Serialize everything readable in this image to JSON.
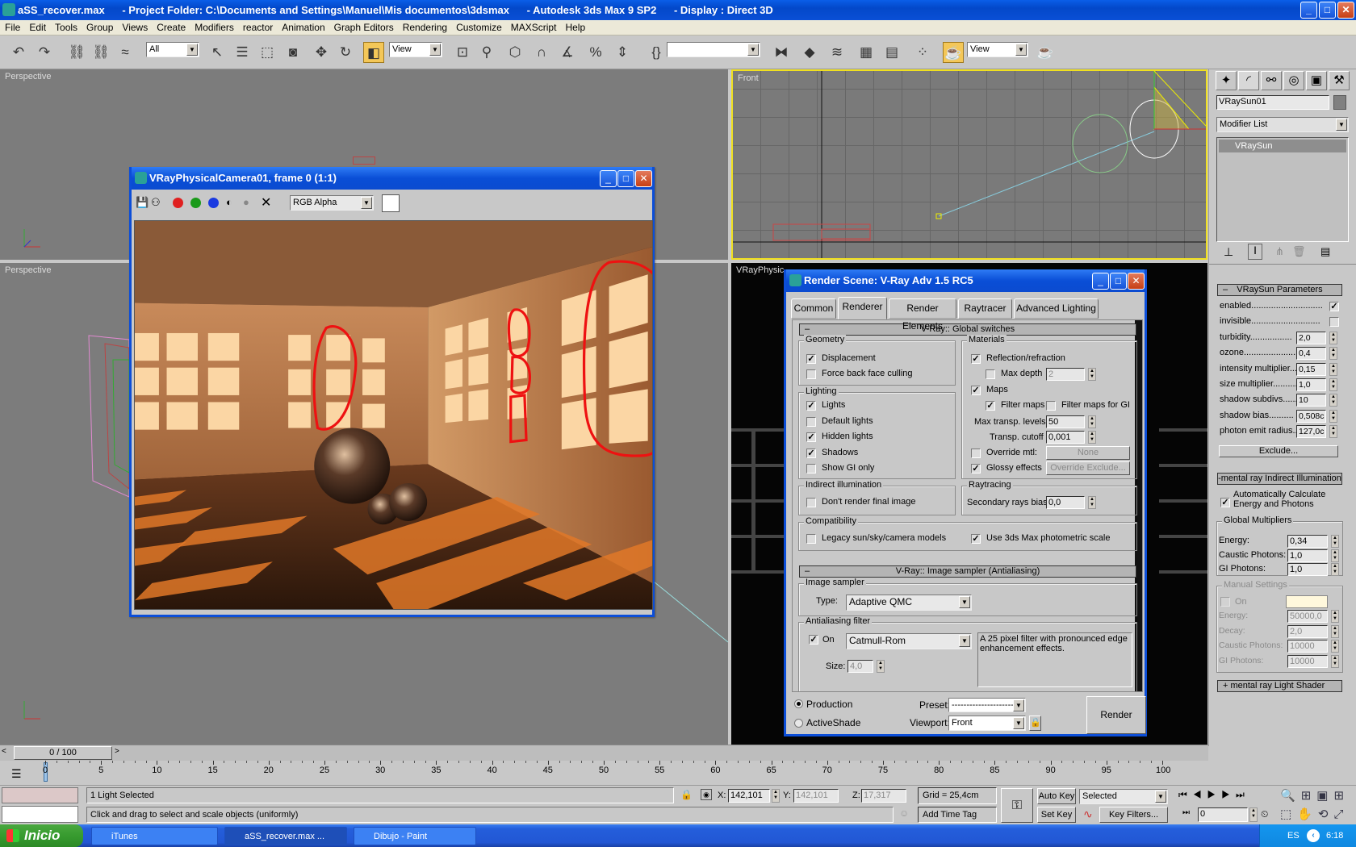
{
  "window": {
    "title": "aSS_recover.max      - Project Folder: C:\\Documents and Settings\\Manuel\\Mis documentos\\3dsmax      - Autodesk 3ds Max 9 SP2      - Display : Direct 3D",
    "minimize": "_",
    "maximize": "□",
    "close": "✕"
  },
  "menu": [
    "File",
    "Edit",
    "Tools",
    "Group",
    "Views",
    "Create",
    "Modifiers",
    "reactor",
    "Animation",
    "Graph Editors",
    "Rendering",
    "Customize",
    "MAXScript",
    "Help"
  ],
  "toolbar": {
    "selection_filter": "All",
    "reference_coord": "View",
    "named_selection": "",
    "render_type": "View",
    "icons": [
      "undo-icon",
      "redo-icon",
      "select-link-icon",
      "unlink-icon",
      "bind-spacewarp-icon",
      "select-object-icon",
      "select-by-name-icon",
      "rect-selection-icon",
      "window-crossing-icon",
      "move-icon",
      "rotate-icon",
      "scale-icon",
      "use-pivot-icon",
      "manipulate-icon",
      "keyboard-shortcut-icon",
      "snap-3d-icon",
      "angle-snap-icon",
      "percent-snap-icon",
      "spinner-snap-icon",
      "edit-named-selection-icon",
      "mirror-icon",
      "align-icon",
      "layer-manager-icon",
      "curve-editor-icon",
      "schematic-view-icon",
      "material-editor-icon",
      "render-scene-icon",
      "quick-render-icon"
    ]
  },
  "viewports": {
    "top_left": "Perspective",
    "bottom_left": "Perspective",
    "top_right": "Front",
    "bottom_right": "VRayPhysic"
  },
  "frame_buffer": {
    "title": "VRayPhysicalCamera01, frame 0 (1:1)",
    "channel": "RGB Alpha"
  },
  "render_scene": {
    "title": "Render Scene: V-Ray Adv 1.5 RC5",
    "tabs": [
      "Common",
      "Renderer",
      "Render Elements",
      "Raytracer",
      "Advanced Lighting"
    ],
    "active_tab": "Renderer",
    "global_switches": {
      "header": "V-Ray:: Global switches",
      "geometry": {
        "label": "Geometry",
        "displacement": {
          "label": "Displacement",
          "checked": true
        },
        "backface": {
          "label": "Force back face culling",
          "checked": false
        }
      },
      "lighting": {
        "label": "Lighting",
        "lights": {
          "label": "Lights",
          "checked": true
        },
        "default_lights": {
          "label": "Default lights",
          "checked": false
        },
        "hidden_lights": {
          "label": "Hidden lights",
          "checked": true
        },
        "shadows": {
          "label": "Shadows",
          "checked": true
        },
        "show_gi": {
          "label": "Show GI only",
          "checked": false
        }
      },
      "indirect": {
        "label": "Indirect illumination",
        "dont_render": {
          "label": "Don't render final image",
          "checked": false
        }
      },
      "compat": {
        "label": "Compatibility",
        "legacy": {
          "label": "Legacy sun/sky/camera models",
          "checked": false
        },
        "photometric": {
          "label": "Use 3ds Max photometric scale",
          "checked": true
        }
      },
      "materials": {
        "label": "Materials",
        "reflection": {
          "label": "Reflection/refraction",
          "checked": true
        },
        "max_depth": {
          "label": "Max depth",
          "checked": false,
          "value": "2"
        },
        "maps": {
          "label": "Maps",
          "checked": true
        },
        "filter_maps": {
          "label": "Filter maps",
          "checked": true
        },
        "filter_gi": {
          "label": "Filter maps for GI",
          "checked": false
        },
        "max_transp": {
          "label": "Max transp. levels",
          "value": "50"
        },
        "transp_cutoff": {
          "label": "Transp. cutoff",
          "value": "0,001"
        },
        "override": {
          "label": "Override mtl:",
          "checked": false,
          "button": "None"
        },
        "glossy": {
          "label": "Glossy effects",
          "checked": true,
          "button": "Override Exclude..."
        }
      },
      "raytracing": {
        "label": "Raytracing",
        "bias_label": "Secondary rays bias",
        "bias": "0,0"
      }
    },
    "image_sampler": {
      "header": "V-Ray:: Image sampler (Antialiasing)",
      "group": "Image sampler",
      "type_label": "Type:",
      "type": "Adaptive QMC",
      "aa_group": "Antialiasing filter",
      "on_label": "On",
      "on": true,
      "filter": "Catmull-Rom",
      "description": "A 25 pixel filter with pronounced edge enhancement effects.",
      "size_label": "Size:",
      "size": "4,0"
    },
    "footer": {
      "production": "Production",
      "activeshade": "ActiveShade",
      "mode": "Production",
      "preset_label": "Preset:",
      "preset": "----------------------",
      "viewport_label": "Viewport:",
      "viewport": "Front",
      "render": "Render"
    }
  },
  "command_panel": {
    "object_name": "VRaySun01",
    "object_color": "#808080",
    "modifier_list": "Modifier List",
    "stack": [
      "VRaySun"
    ],
    "vraysun": {
      "header": "VRaySun Parameters",
      "rows": [
        {
          "label": "enabled.............................",
          "type": "check",
          "checked": true
        },
        {
          "label": "invisible............................",
          "type": "check",
          "checked": false
        },
        {
          "label": "turbidity.................",
          "value": "2,0"
        },
        {
          "label": "ozone.....................",
          "value": "0,4"
        },
        {
          "label": "intensity multiplier....",
          "value": "0,15"
        },
        {
          "label": "size multiplier...........",
          "value": "1,0"
        },
        {
          "label": "shadow subdivs......",
          "value": "10"
        },
        {
          "label": "shadow bias..........",
          "value": "0,508c"
        },
        {
          "label": "photon emit radius..",
          "value": "127,0c"
        }
      ],
      "exclude": "Exclude..."
    },
    "mr_indirect": {
      "header": "-mental ray Indirect Illumination",
      "auto": {
        "label": "Automatically Calculate Energy and Photons",
        "checked": true
      },
      "global": {
        "label": "Global Multipliers",
        "rows": [
          {
            "label": "Energy:",
            "value": "0,34"
          },
          {
            "label": "Caustic Photons:",
            "value": "1,0"
          },
          {
            "label": "GI Photons:",
            "value": "1,0"
          }
        ]
      },
      "manual": {
        "label": "Manual Settings",
        "on": "On",
        "color": "#fff8dc",
        "rows": [
          {
            "label": "Energy:",
            "value": "50000,0"
          },
          {
            "label": "Decay:",
            "value": "2,0"
          },
          {
            "label": "Caustic Photons:",
            "value": "10000"
          },
          {
            "label": "GI Photons:",
            "value": "10000"
          }
        ]
      }
    },
    "mr_shader": "+    mental ray Light Shader"
  },
  "timeline": {
    "frame": "0 / 100",
    "ticks": [
      0,
      5,
      10,
      15,
      20,
      25,
      30,
      35,
      40,
      45,
      50,
      55,
      60,
      65,
      70,
      75,
      80,
      85,
      90,
      95,
      100
    ]
  },
  "status": {
    "selection": "1 Light Selected",
    "prompt": "Click and drag to select and scale objects (uniformly)",
    "x_label": "X:",
    "x": "142,101",
    "y_label": "Y:",
    "y": "142,101",
    "z_label": "Z:",
    "z": "17,317",
    "grid": "Grid = 25,4cm",
    "add_time_tag": "Add Time Tag",
    "auto_key": "Auto Key",
    "set_key": "Set Key",
    "key_mode": "Selected",
    "key_filters": "Key Filters...",
    "current_frame": "0"
  },
  "taskbar": {
    "start": "Inicio",
    "items": [
      "iTunes",
      "aSS_recover.max     ...",
      "Dibujo - Paint"
    ],
    "lang": "ES",
    "clock": "6:18"
  }
}
